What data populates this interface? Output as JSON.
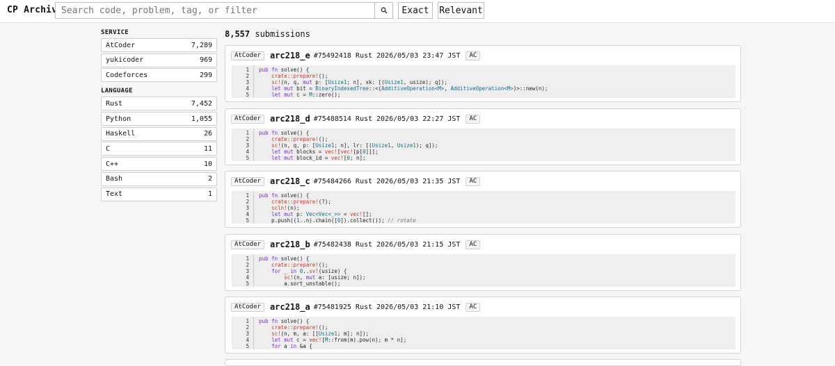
{
  "header": {
    "brand": "CP Archive",
    "search_placeholder": "Search code, problem, tag, or filter",
    "exact_label": "Exact",
    "relevant_label": "Relevant"
  },
  "sidebar": {
    "service_title": "SERVICE",
    "services": [
      {
        "name": "AtCoder",
        "count": "7,289"
      },
      {
        "name": "yukicoder",
        "count": "969"
      },
      {
        "name": "Codeforces",
        "count": "299"
      }
    ],
    "language_title": "LANGUAGE",
    "languages": [
      {
        "name": "Rust",
        "count": "7,452"
      },
      {
        "name": "Python",
        "count": "1,055"
      },
      {
        "name": "Haskell",
        "count": "26"
      },
      {
        "name": "C",
        "count": "11"
      },
      {
        "name": "C++",
        "count": "10"
      },
      {
        "name": "Bash",
        "count": "2"
      },
      {
        "name": "Text",
        "count": "1"
      }
    ]
  },
  "results": {
    "count": "8,557",
    "count_label": "submissions",
    "cards": [
      {
        "service": "AtCoder",
        "problem": "arc218_e",
        "id": "#75492418",
        "lang": "Rust",
        "time": "2026/05/03 23:47 JST",
        "verdict": "AC",
        "lines": [
          "1",
          "2",
          "3",
          "4",
          "5"
        ],
        "code": [
          [
            {
              "c": "kw",
              "t": "pub fn"
            },
            {
              "c": "",
              "t": " solve() {"
            }
          ],
          [
            {
              "c": "",
              "t": "    "
            },
            {
              "c": "mac",
              "t": "crate::prepare!"
            },
            {
              "c": "",
              "t": "();"
            }
          ],
          [
            {
              "c": "",
              "t": "    "
            },
            {
              "c": "mac",
              "t": "sc!"
            },
            {
              "c": "",
              "t": "(n, q, "
            },
            {
              "c": "kw",
              "t": "mut"
            },
            {
              "c": "",
              "t": " p: ["
            },
            {
              "c": "ty",
              "t": "Usize1"
            },
            {
              "c": "",
              "t": "; n], xk: [("
            },
            {
              "c": "ty",
              "t": "Usize1"
            },
            {
              "c": "",
              "t": ", usize); q]);"
            }
          ],
          [
            {
              "c": "",
              "t": "    "
            },
            {
              "c": "kw",
              "t": "let mut"
            },
            {
              "c": "",
              "t": " bit = "
            },
            {
              "c": "ty",
              "t": "BinaryIndexedTree"
            },
            {
              "c": "",
              "t": "::<("
            },
            {
              "c": "ty",
              "t": "AdditiveOperation<M>"
            },
            {
              "c": "",
              "t": ", "
            },
            {
              "c": "ty",
              "t": "AdditiveOperation<M>"
            },
            {
              "c": "",
              "t": ")>::new(n);"
            }
          ],
          [
            {
              "c": "",
              "t": "    "
            },
            {
              "c": "kw",
              "t": "let mut"
            },
            {
              "c": "",
              "t": " c = "
            },
            {
              "c": "ty",
              "t": "M"
            },
            {
              "c": "",
              "t": "::zero();"
            }
          ]
        ]
      },
      {
        "service": "AtCoder",
        "problem": "arc218_d",
        "id": "#75488514",
        "lang": "Rust",
        "time": "2026/05/03 22:27 JST",
        "verdict": "AC",
        "lines": [
          "1",
          "2",
          "3",
          "4",
          "5"
        ],
        "code": [
          [
            {
              "c": "kw",
              "t": "pub fn"
            },
            {
              "c": "",
              "t": " solve() {"
            }
          ],
          [
            {
              "c": "",
              "t": "    "
            },
            {
              "c": "mac",
              "t": "crate::prepare!"
            },
            {
              "c": "",
              "t": "();"
            }
          ],
          [
            {
              "c": "",
              "t": "    "
            },
            {
              "c": "mac",
              "t": "sc!"
            },
            {
              "c": "",
              "t": "(n, q, p: ["
            },
            {
              "c": "ty",
              "t": "Usize1"
            },
            {
              "c": "",
              "t": "; n], lr: [("
            },
            {
              "c": "ty",
              "t": "Usize1"
            },
            {
              "c": "",
              "t": ", "
            },
            {
              "c": "ty",
              "t": "Usize1"
            },
            {
              "c": "",
              "t": "); q]);"
            }
          ],
          [
            {
              "c": "",
              "t": "    "
            },
            {
              "c": "kw",
              "t": "let mut"
            },
            {
              "c": "",
              "t": " blocks = "
            },
            {
              "c": "mac",
              "t": "vec!"
            },
            {
              "c": "",
              "t": "["
            },
            {
              "c": "mac",
              "t": "vec!"
            },
            {
              "c": "",
              "t": "[p["
            },
            {
              "c": "ty",
              "t": "0"
            },
            {
              "c": "",
              "t": "]]];"
            }
          ],
          [
            {
              "c": "",
              "t": "    "
            },
            {
              "c": "kw",
              "t": "let mut"
            },
            {
              "c": "",
              "t": " block_id = "
            },
            {
              "c": "mac",
              "t": "vec!"
            },
            {
              "c": "",
              "t": "["
            },
            {
              "c": "ty",
              "t": "0"
            },
            {
              "c": "",
              "t": "; n];"
            }
          ]
        ]
      },
      {
        "service": "AtCoder",
        "problem": "arc218_c",
        "id": "#75484266",
        "lang": "Rust",
        "time": "2026/05/03 21:35 JST",
        "verdict": "AC",
        "lines": [
          "1",
          "2",
          "3",
          "4",
          "5"
        ],
        "code": [
          [
            {
              "c": "kw",
              "t": "pub fn"
            },
            {
              "c": "",
              "t": " solve() {"
            }
          ],
          [
            {
              "c": "",
              "t": "    "
            },
            {
              "c": "mac",
              "t": "crate::prepare!"
            },
            {
              "c": "",
              "t": "(?);"
            }
          ],
          [
            {
              "c": "",
              "t": "    "
            },
            {
              "c": "mac",
              "t": "scln!"
            },
            {
              "c": "",
              "t": "(n);"
            }
          ],
          [
            {
              "c": "",
              "t": "    "
            },
            {
              "c": "kw",
              "t": "let mut"
            },
            {
              "c": "",
              "t": " p: "
            },
            {
              "c": "ty",
              "t": "Vec<Vec<_>>"
            },
            {
              "c": "",
              "t": " = "
            },
            {
              "c": "mac",
              "t": "vec!"
            },
            {
              "c": "",
              "t": "[];"
            }
          ],
          [
            {
              "c": "",
              "t": "    p.push(("
            },
            {
              "c": "ty",
              "t": "1"
            },
            {
              "c": "",
              "t": "..n).chain(["
            },
            {
              "c": "ty",
              "t": "0"
            },
            {
              "c": "",
              "t": "]).collect()); "
            },
            {
              "c": "cm",
              "t": "// rotate"
            }
          ]
        ]
      },
      {
        "service": "AtCoder",
        "problem": "arc218_b",
        "id": "#75482438",
        "lang": "Rust",
        "time": "2026/05/03 21:15 JST",
        "verdict": "AC",
        "lines": [
          "1",
          "2",
          "3",
          "4",
          "5"
        ],
        "code": [
          [
            {
              "c": "kw",
              "t": "pub fn"
            },
            {
              "c": "",
              "t": " solve() {"
            }
          ],
          [
            {
              "c": "",
              "t": "    "
            },
            {
              "c": "mac",
              "t": "crate::prepare!"
            },
            {
              "c": "",
              "t": "();"
            }
          ],
          [
            {
              "c": "",
              "t": "    "
            },
            {
              "c": "kw",
              "t": "for"
            },
            {
              "c": "",
              "t": " _ "
            },
            {
              "c": "kw",
              "t": "in"
            },
            {
              "c": "",
              "t": " "
            },
            {
              "c": "ty",
              "t": "0"
            },
            {
              "c": "",
              "t": ".."
            },
            {
              "c": "mac",
              "t": "sv!"
            },
            {
              "c": "",
              "t": "(usize) {"
            }
          ],
          [
            {
              "c": "",
              "t": "        "
            },
            {
              "c": "mac",
              "t": "sc!"
            },
            {
              "c": "",
              "t": "(n, "
            },
            {
              "c": "kw",
              "t": "mut"
            },
            {
              "c": "",
              "t": " a: [usize; n]);"
            }
          ],
          [
            {
              "c": "",
              "t": "        a.sort_unstable();"
            }
          ]
        ]
      },
      {
        "service": "AtCoder",
        "problem": "arc218_a",
        "id": "#75481925",
        "lang": "Rust",
        "time": "2026/05/03 21:10 JST",
        "verdict": "AC",
        "lines": [
          "1",
          "2",
          "3",
          "4",
          "5"
        ],
        "code": [
          [
            {
              "c": "kw",
              "t": "pub fn"
            },
            {
              "c": "",
              "t": " solve() {"
            }
          ],
          [
            {
              "c": "",
              "t": "    "
            },
            {
              "c": "mac",
              "t": "crate::prepare!"
            },
            {
              "c": "",
              "t": "();"
            }
          ],
          [
            {
              "c": "",
              "t": "    "
            },
            {
              "c": "mac",
              "t": "sc!"
            },
            {
              "c": "",
              "t": "(n, m, a: [["
            },
            {
              "c": "ty",
              "t": "Usize1"
            },
            {
              "c": "",
              "t": "; m]; n]);"
            }
          ],
          [
            {
              "c": "",
              "t": "    "
            },
            {
              "c": "kw",
              "t": "let mut"
            },
            {
              "c": "",
              "t": " c = "
            },
            {
              "c": "mac",
              "t": "vec!"
            },
            {
              "c": "",
              "t": "["
            },
            {
              "c": "ty",
              "t": "M"
            },
            {
              "c": "",
              "t": "::from(m).pow(n); m * n];"
            }
          ],
          [
            {
              "c": "",
              "t": "    "
            },
            {
              "c": "kw",
              "t": "for"
            },
            {
              "c": "",
              "t": " a "
            },
            {
              "c": "kw",
              "t": "in"
            },
            {
              "c": "",
              "t": " &a {"
            }
          ]
        ]
      }
    ]
  }
}
